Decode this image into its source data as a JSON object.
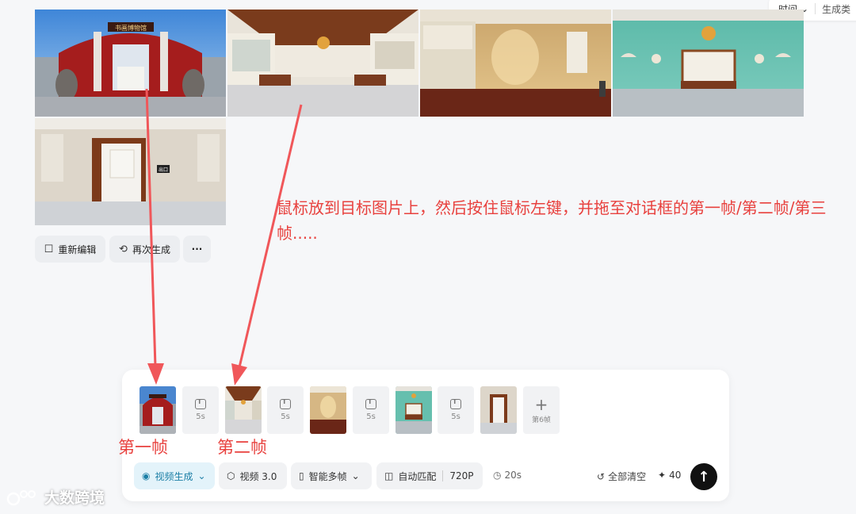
{
  "sort_bar": {
    "sort_label": "时间",
    "type_label": "生成类"
  },
  "actions": {
    "reedit": "重新编辑",
    "regenerate": "再次生成",
    "more": "···"
  },
  "annotation": {
    "instruction": "鼠标放到目标图片上，然后按住鼠标左键，并拖至对话框的第一帧/第二帧/第三帧.....",
    "first_frame_label": "第一帧",
    "second_frame_label": "第二帧"
  },
  "signs": {
    "museum_plaque": "书画博物馆",
    "exit_sign": "出口"
  },
  "dialog": {
    "transition_duration": "5s",
    "add_frame_label": "第6帧",
    "mode": "视频生成",
    "model": "视频 3.0",
    "frame_mode": "智能多帧",
    "ratio": "自动匹配",
    "resolution": "720P",
    "total_duration": "20s",
    "clear_all": "全部清空",
    "credits": "40"
  },
  "watermark": "大数跨境",
  "icons": [
    "chevron-down-icon",
    "edit-icon",
    "refresh-icon",
    "more-icon",
    "play-circle-icon",
    "cube-icon",
    "frames-icon",
    "ratio-icon",
    "clock-icon",
    "undo-icon",
    "sparkle-icon",
    "arrow-up-icon",
    "plus-icon",
    "text-transition-icon"
  ],
  "colors": {
    "annotation_red": "#e8413e",
    "accent_blue": "#1c7fa6",
    "send_button": "#111111"
  }
}
